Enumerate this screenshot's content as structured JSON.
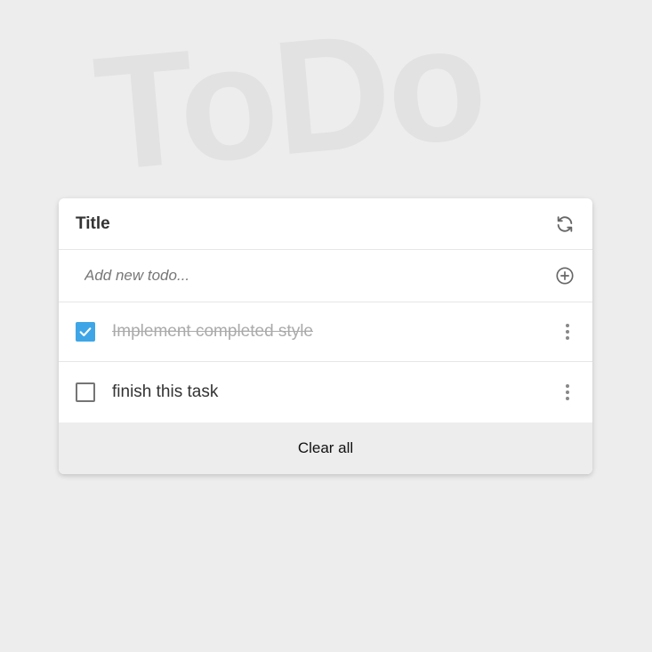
{
  "watermark": "ToDo",
  "card": {
    "title": "Title",
    "refresh_icon": "refresh-icon",
    "add": {
      "placeholder": "Add new todo...",
      "value": "",
      "icon": "add-circle-icon"
    },
    "todos": [
      {
        "text": "Implement completed style",
        "completed": true
      },
      {
        "text": "finish this task",
        "completed": false
      }
    ],
    "clear_label": "Clear all"
  },
  "colors": {
    "accent": "#3ea6e6",
    "background": "#ededed",
    "card": "#ffffff",
    "completed_text": "#aaaaaa"
  }
}
